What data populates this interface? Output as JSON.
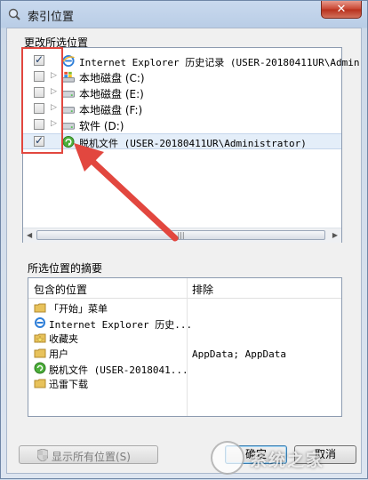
{
  "window": {
    "title": "索引位置",
    "close_label": "✕"
  },
  "locations": {
    "section_label": "更改所选位置",
    "items": [
      {
        "label": "Internet Explorer 历史记录 (USER-20180411UR\\Admin",
        "checked": true,
        "icon": "ie-icon",
        "expandable": false
      },
      {
        "label": "本地磁盘 (C:)",
        "checked": false,
        "icon": "windows-drive-icon",
        "expandable": true
      },
      {
        "label": "本地磁盘 (E:)",
        "checked": false,
        "icon": "drive-icon",
        "expandable": true
      },
      {
        "label": "本地磁盘 (F:)",
        "checked": false,
        "icon": "drive-icon",
        "expandable": true
      },
      {
        "label": "软件 (D:)",
        "checked": false,
        "icon": "drive-icon",
        "expandable": true
      },
      {
        "label": "脱机文件 (USER-20180411UR\\Administrator)",
        "checked": true,
        "icon": "offline-files-icon",
        "expandable": false
      }
    ],
    "scroll_thumb_grip": "|||"
  },
  "summary": {
    "section_label": "所选位置的摘要",
    "col_included": "包含的位置",
    "col_exclude": "排除",
    "items": [
      {
        "label": "「开始」菜单",
        "icon": "folder-icon"
      },
      {
        "label": "Internet Explorer 历史...",
        "icon": "ie-icon"
      },
      {
        "label": "收藏夹",
        "icon": "favorites-folder-icon"
      },
      {
        "label": "用户",
        "icon": "folder-icon"
      },
      {
        "label": "脱机文件 (USER-2018041...",
        "icon": "offline-files-icon"
      },
      {
        "label": "迅雷下载",
        "icon": "folder-icon"
      }
    ],
    "exclude_value": "AppData; AppData"
  },
  "buttons": {
    "show_all": "显示所有位置(S)",
    "ok": "确定",
    "cancel": "取消"
  },
  "colors": {
    "annotation_red": "#e2473f",
    "selection": "#e4eef9"
  },
  "watermark": {
    "text": "系统之家"
  }
}
